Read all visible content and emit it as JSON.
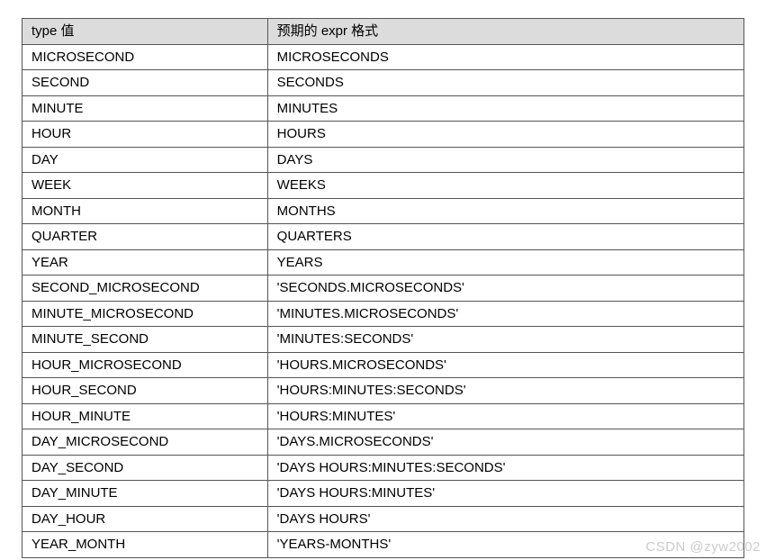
{
  "chart_data": {
    "type": "table",
    "headers": [
      "type 值",
      "预期的 expr 格式"
    ],
    "rows": [
      [
        "MICROSECOND",
        "MICROSECONDS"
      ],
      [
        "SECOND",
        "SECONDS"
      ],
      [
        "MINUTE",
        "MINUTES"
      ],
      [
        "HOUR",
        "HOURS"
      ],
      [
        "DAY",
        "DAYS"
      ],
      [
        "WEEK",
        "WEEKS"
      ],
      [
        "MONTH",
        "MONTHS"
      ],
      [
        "QUARTER",
        "QUARTERS"
      ],
      [
        "YEAR",
        "YEARS"
      ],
      [
        "SECOND_MICROSECOND",
        "'SECONDS.MICROSECONDS'"
      ],
      [
        "MINUTE_MICROSECOND",
        "'MINUTES.MICROSECONDS'"
      ],
      [
        "MINUTE_SECOND",
        "'MINUTES:SECONDS'"
      ],
      [
        "HOUR_MICROSECOND",
        "'HOURS.MICROSECONDS'"
      ],
      [
        "HOUR_SECOND",
        "'HOURS:MINUTES:SECONDS'"
      ],
      [
        "HOUR_MINUTE",
        "'HOURS:MINUTES'"
      ],
      [
        "DAY_MICROSECOND",
        "'DAYS.MICROSECONDS'"
      ],
      [
        "DAY_SECOND",
        "'DAYS HOURS:MINUTES:SECONDS'"
      ],
      [
        "DAY_MINUTE",
        "'DAYS HOURS:MINUTES'"
      ],
      [
        "DAY_HOUR",
        "'DAYS HOURS'"
      ],
      [
        "YEAR_MONTH",
        "'YEARS-MONTHS'"
      ]
    ]
  },
  "watermark": "CSDN @zyw2002"
}
